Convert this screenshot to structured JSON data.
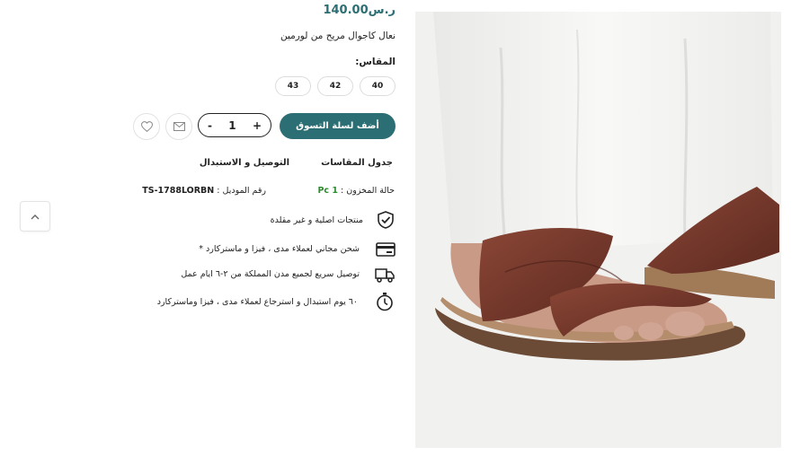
{
  "product": {
    "price": "ر.س140.00",
    "title": "نعال كاجوال مريح من لورمين",
    "size_label": "المقاس:",
    "sizes": [
      "40",
      "42",
      "43"
    ],
    "add_to_cart": "أضف لسلة التسوق",
    "quantity": "1",
    "qty_minus": "-",
    "qty_plus": "+",
    "size_chart": "جدول المقاسات",
    "delivery": "التوصيل و الاستبدال",
    "stock_label": "حالة المخزون :",
    "stock_value": "1 Pc",
    "model_label": "رقم الموديل :",
    "model_value": "TS-1788LORBN",
    "features": [
      {
        "icon": "badge-check-icon",
        "text": "منتجات اصلية و غير مقلدة"
      },
      {
        "icon": "credit-card-icon",
        "text": "شحن مجاني لعملاء مدى ، فيزا و ماستركارد *"
      },
      {
        "icon": "delivery-truck-icon",
        "text": "توصيل سريع لجميع مدن المملكة من ٢-٦ ايام عمل"
      },
      {
        "icon": "stopwatch-icon",
        "text": "٦٠ يوم استبدال و استرجاع لعملاء مدى ، فيزا وماستركارد"
      }
    ]
  },
  "colors": {
    "accent": "#2b6e73",
    "stock_green": "#2e8b2e",
    "sandal_brown": "#7a3a2c"
  }
}
